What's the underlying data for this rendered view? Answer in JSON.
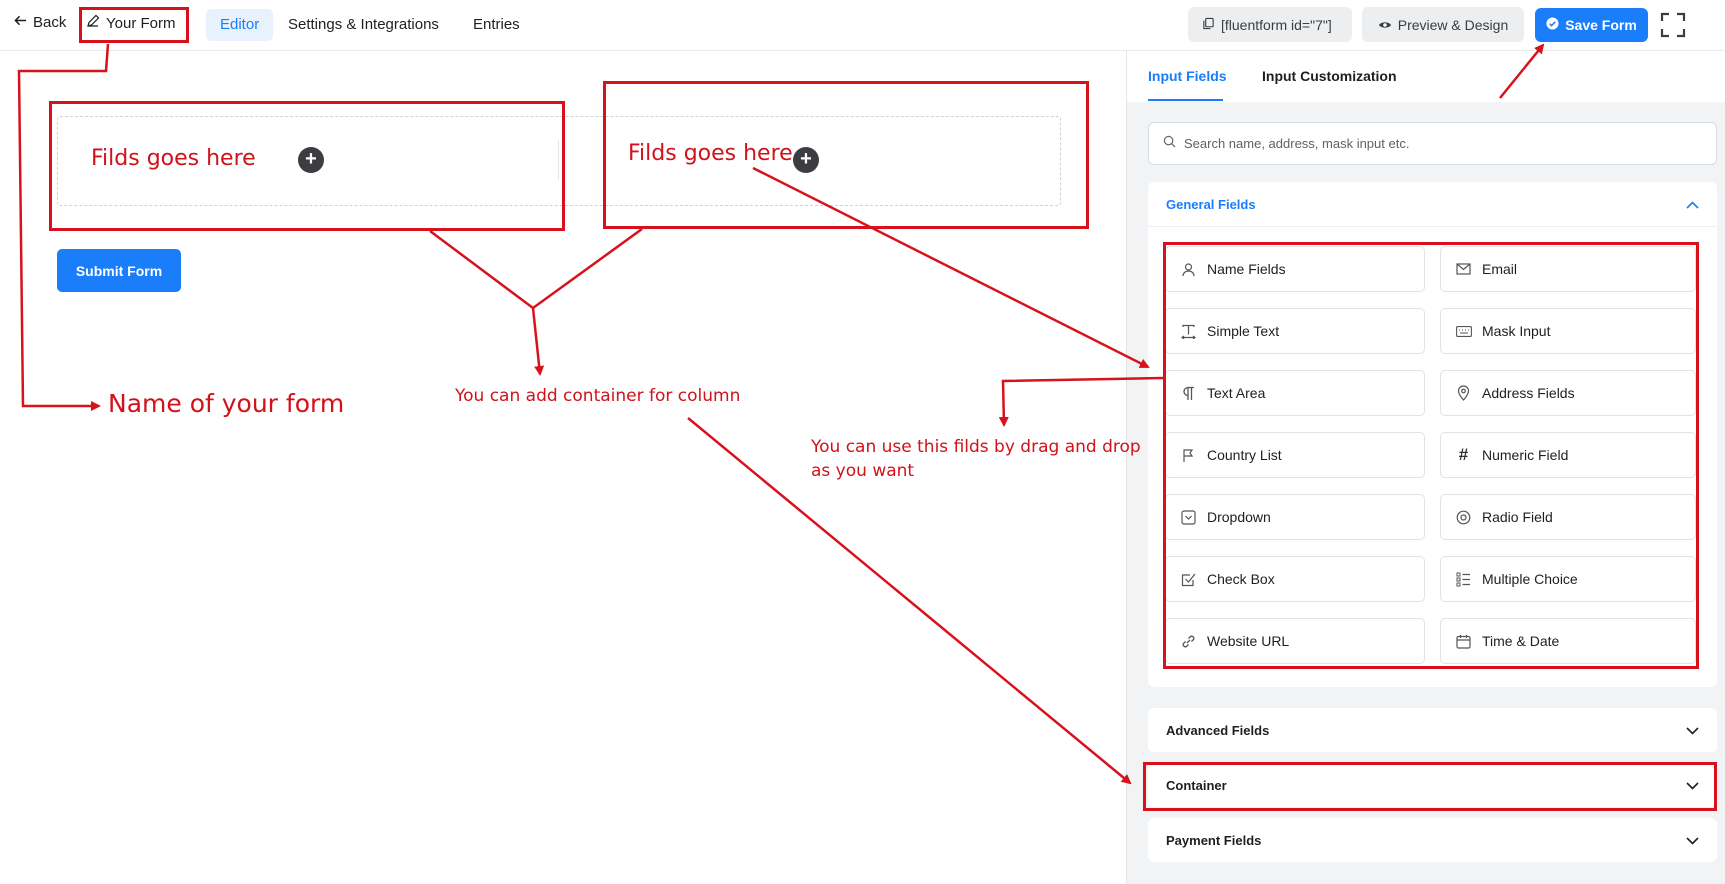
{
  "topbar": {
    "back_label": "Back",
    "form_name": "Your Form",
    "tabs": [
      {
        "label": "Editor",
        "active": true
      },
      {
        "label": "Settings & Integrations",
        "active": false
      },
      {
        "label": "Entries",
        "active": false
      }
    ],
    "shortcode": "[fluentform id=\"7\"]",
    "preview_label": "Preview & Design",
    "save_label": "Save Form"
  },
  "canvas": {
    "submit_label": "Submit Form"
  },
  "annotations": {
    "fields_here_1": "Filds goes here",
    "fields_here_2": "Filds goes here",
    "name_of_form": "Name of your form",
    "container_note": "You can add container for column",
    "drag_drop_line1": "You can use this filds by drag and drop",
    "drag_drop_line2": "as you want"
  },
  "panel": {
    "tabs": [
      {
        "label": "Input Fields",
        "active": true
      },
      {
        "label": "Input Customization",
        "active": false
      }
    ],
    "search_placeholder": "Search name, address, mask input etc.",
    "general_title": "General Fields",
    "fields": [
      {
        "label": "Name Fields",
        "icon": "user-icon"
      },
      {
        "label": "Email",
        "icon": "envelope-icon"
      },
      {
        "label": "Simple Text",
        "icon": "text-cursor-icon"
      },
      {
        "label": "Mask Input",
        "icon": "keyboard-icon"
      },
      {
        "label": "Text Area",
        "icon": "paragraph-icon"
      },
      {
        "label": "Address Fields",
        "icon": "map-pin-icon"
      },
      {
        "label": "Country List",
        "icon": "flag-icon"
      },
      {
        "label": "Numeric Field",
        "icon": "hash-icon"
      },
      {
        "label": "Dropdown",
        "icon": "dropdown-icon"
      },
      {
        "label": "Radio Field",
        "icon": "radio-icon"
      },
      {
        "label": "Check Box",
        "icon": "checkbox-icon"
      },
      {
        "label": "Multiple Choice",
        "icon": "list-icon"
      },
      {
        "label": "Website URL",
        "icon": "link-icon"
      },
      {
        "label": "Time & Date",
        "icon": "calendar-icon"
      }
    ],
    "sections": [
      {
        "label": "Advanced Fields"
      },
      {
        "label": "Container"
      },
      {
        "label": "Payment Fields"
      }
    ]
  },
  "colors": {
    "accent": "#1a7efb",
    "annotation_red": "#d7121c"
  }
}
